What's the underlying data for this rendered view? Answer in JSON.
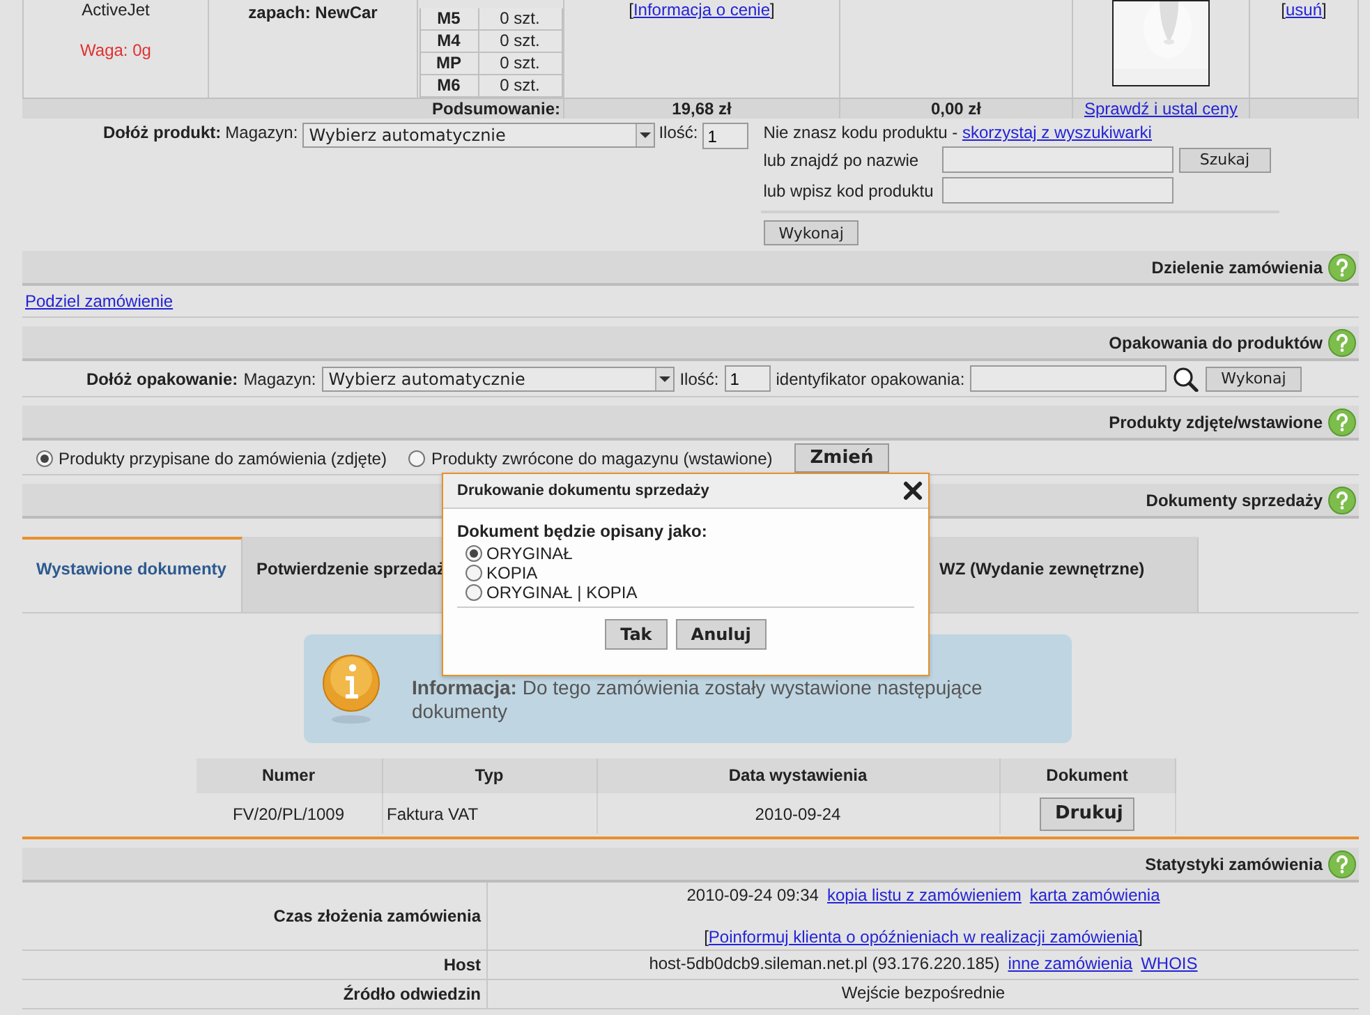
{
  "product_row": {
    "name": "ActiveJet",
    "weight": "Waga: 0g",
    "description": "zapach: NewCar",
    "stock": [
      {
        "warehouse": "M5",
        "qty": "0 szt."
      },
      {
        "warehouse": "M4",
        "qty": "0 szt."
      },
      {
        "warehouse": "MP",
        "qty": "0 szt."
      },
      {
        "warehouse": "M6",
        "qty": "0 szt."
      }
    ],
    "price_info": {
      "before": "[",
      "link": "Informacja o cenie",
      "after": "]"
    },
    "remove": {
      "before": "[",
      "link": "usuń",
      "after": "]"
    }
  },
  "summary": {
    "label": "Podsumowanie:",
    "value_1": "19,68 zł",
    "value_2": "0,00 zł",
    "link": "Sprawdź i ustal ceny"
  },
  "add_product": {
    "label": "Dołóż produkt:",
    "warehouse_label": "Magazyn:",
    "warehouse_value": "Wybierz automatycznie",
    "qty_label": "Ilość:",
    "qty_value": "1",
    "hint": "Nie znasz kodu produktu - ",
    "hint_link": "skorzystaj z wyszukiwarki",
    "name_label": "lub znajdź po nazwie",
    "search_button": "Szukaj",
    "code_label": "lub wpisz kod produktu",
    "run_button": "Wykonaj"
  },
  "split_section": {
    "title": "Dzielenie zamówienia",
    "link": "Podziel zamówienie"
  },
  "packaging_section": {
    "title": "Opakowania do produktów",
    "label": "Dołóż opakowanie:",
    "warehouse_label": "Magazyn:",
    "warehouse_value": "Wybierz automatycznie",
    "qty_label": "Ilość:",
    "qty_value": "1",
    "id_label": "identyfikator opakowania:",
    "run_button": "Wykonaj"
  },
  "removed_section": {
    "title": "Produkty zdjęte/wstawione",
    "options": [
      {
        "label": "Produkty przypisane do zamówienia (zdjęte)",
        "selected": true
      },
      {
        "label": "Produkty zwrócone do magazynu (wstawione)",
        "selected": false
      }
    ],
    "button": "Zmień"
  },
  "documents_section": {
    "title": "Dokumenty sprzedaży",
    "tabs": [
      {
        "label": "Wystawione dokumenty",
        "selected": true
      },
      {
        "label": "Potwierdzenie sprzedaż",
        "selected": false
      },
      {
        "label": "WZ (Wydanie zewnętrzne)",
        "selected": false
      }
    ],
    "info": "**Informacja:** Do tego zamówienia zostały wystawione następujące dokumenty",
    "table": {
      "columns": [
        "Numer",
        "Typ",
        "Data wystawienia",
        "Dokument"
      ],
      "rows": [
        {
          "number": "FV/20/PL/1009",
          "type": "Faktura VAT",
          "date": "2010-09-24",
          "button": "Drukuj"
        }
      ]
    }
  },
  "stats_section": {
    "title": "Statystyki zamówienia",
    "order_time": {
      "label": "Czas złożenia zamówienia",
      "value": "2010-09-24 09:34",
      "links": [
        "kopia listu z zamówieniem",
        "karta zamówienia"
      ],
      "notify_before": "[",
      "notify_link": "Poinformuj klienta o opóźnieniach w realizacji zamówienia",
      "notify_after": "]"
    },
    "host": {
      "label": "Host",
      "value": "host-5db0dcb9.sileman.net.pl (93.176.220.185)",
      "links": [
        "inne zamówienia",
        "WHOIS"
      ]
    },
    "source": {
      "label": "Źródło odwiedzin",
      "value": "Wejście bezpośrednie"
    }
  },
  "dialog": {
    "title": "Drukowanie dokumentu sprzedaży",
    "prompt": "Dokument będzie opisany jako:",
    "options": [
      {
        "label": "ORYGINAŁ",
        "selected": true
      },
      {
        "label": "KOPIA",
        "selected": false
      },
      {
        "label": "ORYGINAŁ | KOPIA",
        "selected": false
      }
    ],
    "buttons": [
      "Tak",
      "Anuluj"
    ]
  }
}
